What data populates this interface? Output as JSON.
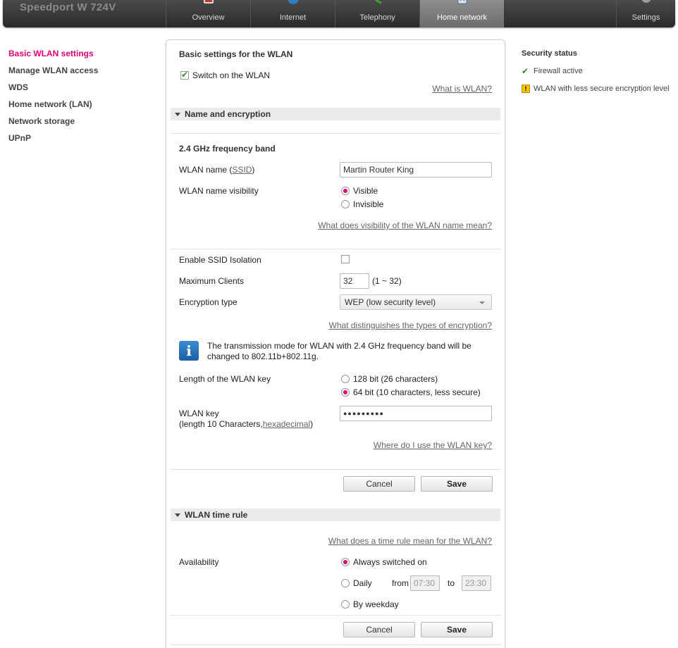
{
  "header": {
    "brand": "Speedport W 724V",
    "tabs": [
      {
        "label": "Overview",
        "icon": "overview-icon",
        "active": false
      },
      {
        "label": "Internet",
        "icon": "globe-icon",
        "active": false
      },
      {
        "label": "Telephony",
        "icon": "phone-icon",
        "active": false
      },
      {
        "label": "Home network",
        "icon": "home-network-icon",
        "active": true
      },
      {
        "label": "Settings",
        "icon": "gear-icon",
        "active": false
      }
    ]
  },
  "sidebar": {
    "items": [
      {
        "label": "Basic WLAN settings",
        "active": true
      },
      {
        "label": "Manage WLAN access",
        "active": false
      },
      {
        "label": "WDS",
        "active": false
      },
      {
        "label": "Home network (LAN)",
        "active": false
      },
      {
        "label": "Network storage",
        "active": false
      },
      {
        "label": "UPnP",
        "active": false
      }
    ]
  },
  "main": {
    "heading": "Basic settings for the WLAN",
    "switch_on_label": "Switch on the WLAN",
    "switch_on_checked": true,
    "what_is_wlan_link": "What is WLAN?",
    "name_encryption": {
      "section_title": "Name and encryption",
      "band_heading": "2.4 GHz frequency band",
      "wlan_name_label_prefix": "WLAN name (",
      "wlan_name_label_link": "SSID",
      "wlan_name_label_suffix": ")",
      "wlan_name_value": "Martin Router King",
      "visibility_label": "WLAN name visibility",
      "visible_option": "Visible",
      "invisible_option": "Invisible",
      "visibility_selected": "Visible",
      "visibility_help_link": "What does visibility of the WLAN name mean?",
      "ssid_isolation_label": "Enable SSID Isolation",
      "ssid_isolation_checked": false,
      "max_clients_label": "Maximum Clients",
      "max_clients_value": "32",
      "max_clients_range": "(1 ~ 32)",
      "encryption_label": "Encryption type",
      "encryption_value": "WEP (low security level)",
      "encryption_help_link": "What distinguishes the types of encryption?",
      "info_text": "The transmission mode for WLAN with 2.4 GHz frequency band will be changed to 802.11b+802.11g.",
      "key_length_label": "Length of the WLAN key",
      "key_128_option": "128 bit (26 characters)",
      "key_64_option": "64 bit (10 characters, less secure)",
      "key_length_selected": "64 bit",
      "wlan_key_label": "WLAN key",
      "wlan_key_sub_prefix": "(length 10 Characters,",
      "wlan_key_sub_link": "hexadecimal",
      "wlan_key_sub_suffix": ")",
      "wlan_key_value": "●●●●●●●●●",
      "wlan_key_help_link": "Where do I use the WLAN key?",
      "cancel_label": "Cancel",
      "save_label": "Save"
    },
    "time_rule": {
      "section_title": "WLAN time rule",
      "help_link": "What does a time rule mean for the WLAN?",
      "availability_label": "Availability",
      "always_on_option": "Always switched on",
      "daily_option": "Daily",
      "from_label": "from",
      "from_value": "07:30",
      "to_label": "to",
      "to_value": "23:30",
      "weekday_option": "By weekday",
      "selected": "Always switched on",
      "cancel_label": "Cancel",
      "save_label": "Save"
    }
  },
  "security_status": {
    "title": "Security status",
    "items": [
      {
        "text": "Firewall active",
        "icon": "check-icon"
      },
      {
        "text": "WLAN with less secure encryption level",
        "icon": "warning-icon"
      }
    ]
  },
  "colors": {
    "accent": "#e20074",
    "header_bg": "#333333",
    "active_tab": "#7a7a7a",
    "ok_green": "#3a8a2a",
    "warning_yellow": "#f5c400"
  }
}
